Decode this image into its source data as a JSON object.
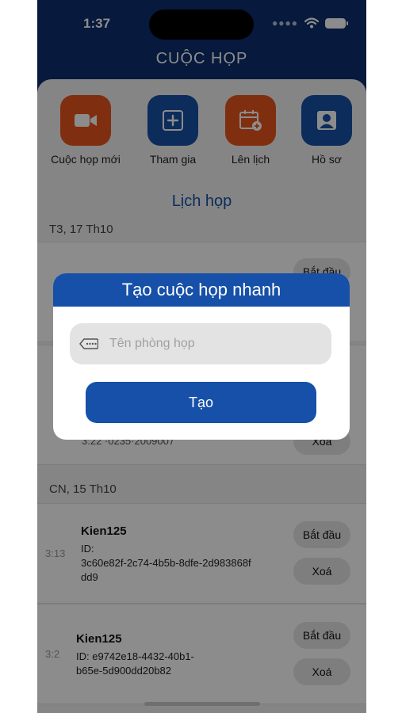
{
  "status": {
    "time": "1:37"
  },
  "app_title": "CUỘC HỌP",
  "actions": [
    {
      "label": "Cuộc họp mới",
      "icon": "video-camera-icon",
      "color": "#e8571e"
    },
    {
      "label": "Tham gia",
      "icon": "plus-icon",
      "color": "#1650a8"
    },
    {
      "label": "Lên lịch",
      "icon": "calendar-icon",
      "color": "#e8571e"
    },
    {
      "label": "Hồ sơ",
      "icon": "profile-icon",
      "color": "#1650a8"
    }
  ],
  "schedule_title": "Lịch họp",
  "groups": [
    {
      "date": "T3, 17 Th10",
      "meetings": [
        {
          "start_label": "Bắt đầu"
        },
        {
          "id_fragment": "3:22 ·0235·2009007",
          "delete_label": "Xoá"
        }
      ]
    },
    {
      "date": "CN, 15 Th10",
      "meetings": [
        {
          "time": "3:13",
          "name": "Kien125",
          "id_line1": "ID:",
          "id_line2": "3c60e82f-2c74-4b5b-8dfe-2d983868f",
          "id_line3": "dd9",
          "start_label": "Bắt đầu",
          "delete_label": "Xoá"
        },
        {
          "time": "3:2",
          "name": "Kien125",
          "id_line1": "ID: e9742e18-4432-40b1-",
          "id_line2": "b65e-5d900dd20b82",
          "start_label": "Bắt đầu",
          "delete_label": "Xoá"
        }
      ]
    }
  ],
  "dialog": {
    "title": "Tạo cuộc họp nhanh",
    "input_placeholder": "Tên phòng họp",
    "input_value": "",
    "create_label": "Tạo"
  },
  "colors": {
    "primary": "#1650a8",
    "accent": "#e8571e",
    "header": "#0d2f6e"
  }
}
